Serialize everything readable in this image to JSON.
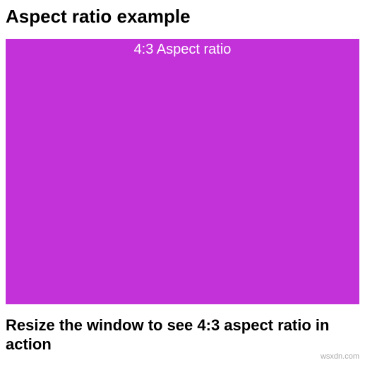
{
  "page": {
    "title": "Aspect ratio example",
    "instruction": "Resize the window to see 4:3 aspect ratio in action"
  },
  "box": {
    "label": "4:3 Aspect ratio",
    "background_color": "#c331d8",
    "text_color": "#ffffff",
    "aspect_ratio": "4:3"
  },
  "watermark": "wsxdn.com"
}
